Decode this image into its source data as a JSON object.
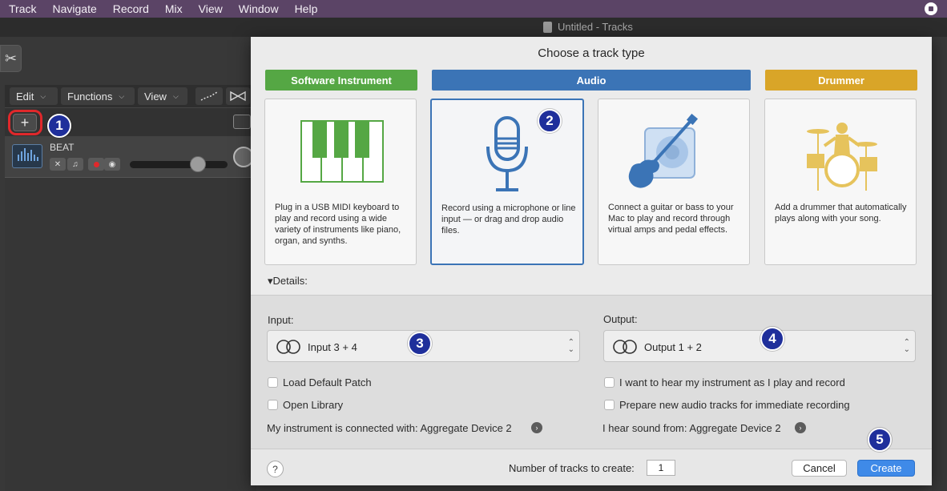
{
  "menubar": {
    "items": [
      "Track",
      "Navigate",
      "Record",
      "Mix",
      "View",
      "Window",
      "Help"
    ],
    "background": "#5b4466"
  },
  "window": {
    "title": "Untitled - Tracks"
  },
  "left_panel": {
    "toolbar": [
      {
        "label": "Edit"
      },
      {
        "label": "Functions"
      },
      {
        "label": "View"
      }
    ],
    "add_track_symbol": "+",
    "track": {
      "name": "BEAT"
    }
  },
  "dialog": {
    "title": "Choose a track type",
    "categories": [
      {
        "label": "Software Instrument",
        "color": "#55a744"
      },
      {
        "label": "Audio",
        "color": "#3b74b6"
      },
      {
        "label": "Drummer",
        "color": "#d9a528"
      }
    ],
    "cards": [
      {
        "icon": "piano-keyboard-icon",
        "description": "Plug in a USB MIDI keyboard to play and record using a wide variety of instruments like piano, organ, and synths."
      },
      {
        "icon": "microphone-icon",
        "description": "Record using a microphone or line input — or drag and drop audio files.",
        "selected": true
      },
      {
        "icon": "guitar-amp-icon",
        "description": "Connect a guitar or bass to your Mac to play and record through virtual amps and pedal effects."
      },
      {
        "icon": "drummer-icon",
        "description": "Add a drummer that automatically plays along with your song."
      }
    ],
    "details_label": "Details:",
    "input": {
      "label": "Input:",
      "value": "Input 3 + 4",
      "checkboxes": [
        "Load Default Patch",
        "Open Library"
      ],
      "connected_text": "My instrument is connected with: Aggregate Device 2"
    },
    "output": {
      "label": "Output:",
      "value": "Output 1 + 2",
      "checkboxes": [
        "I want to hear my instrument as I play and record",
        "Prepare new audio tracks for immediate recording"
      ],
      "hear_text": "I hear sound from: Aggregate Device 2"
    },
    "footer": {
      "help": "?",
      "num_tracks_label": "Number of tracks to create:",
      "num_tracks_value": "1",
      "cancel": "Cancel",
      "create": "Create"
    }
  },
  "step_markers": [
    "1",
    "2",
    "3",
    "4",
    "5"
  ]
}
